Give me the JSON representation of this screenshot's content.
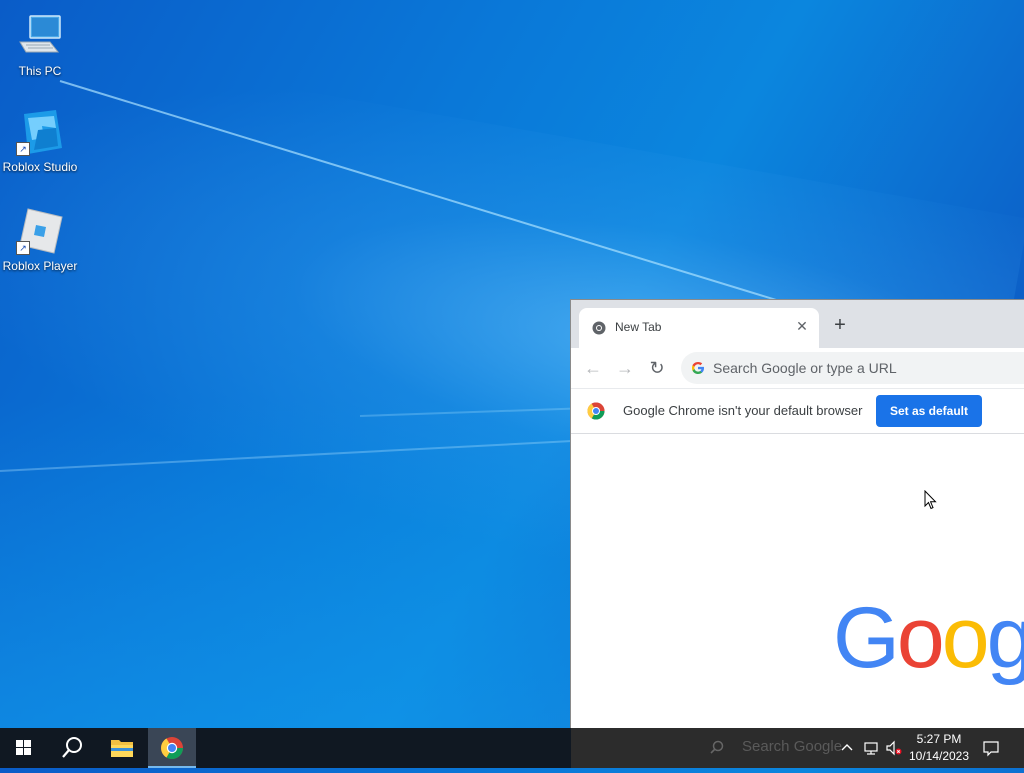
{
  "desktop": {
    "icons": [
      {
        "label": "This PC",
        "icon": "computer-icon"
      },
      {
        "label": "Roblox Studio",
        "icon": "roblox-studio-icon"
      },
      {
        "label": "Roblox Player",
        "icon": "roblox-player-icon"
      }
    ]
  },
  "browser": {
    "tab": {
      "title": "New Tab",
      "close": "✕",
      "icon": "chrome-icon"
    },
    "new_tab": "+",
    "nav": {
      "back": "←",
      "forward": "→",
      "reload": "↻"
    },
    "omnibox": {
      "placeholder": "Search Google or type a URL"
    },
    "infobar": {
      "message": "Google Chrome isn't your default browser",
      "button": "Set as default"
    },
    "logo": {
      "g": "G",
      "o1": "o",
      "o2": "o",
      "g2": "g"
    }
  },
  "taskbar": {
    "search_ghost": "Search Google",
    "clock": {
      "time": "5:27 PM",
      "date": "10/14/2023"
    },
    "tray": {
      "chevron": "^",
      "network": "network-icon",
      "volume": "volume-muted-icon",
      "notifications": "notification-icon"
    }
  },
  "colors": {
    "chrome_blue": "#1a73e8",
    "google_blue": "#4285f4",
    "google_red": "#ea4335",
    "google_yellow": "#fbbc05",
    "google_green": "#34a853"
  }
}
